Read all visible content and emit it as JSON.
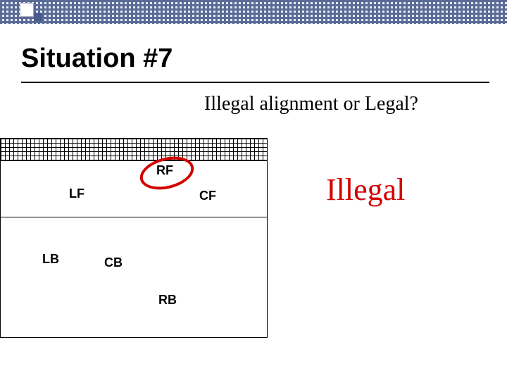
{
  "title": "Situation #7",
  "question": "Illegal alignment or Legal?",
  "positions": {
    "rf": "RF",
    "lf": "LF",
    "cf": "CF",
    "lb": "LB",
    "cb": "CB",
    "rb": "RB"
  },
  "verdict": "Illegal",
  "highlight": "rf",
  "colors": {
    "verdict": "#d40000",
    "oval": "#d40000"
  }
}
